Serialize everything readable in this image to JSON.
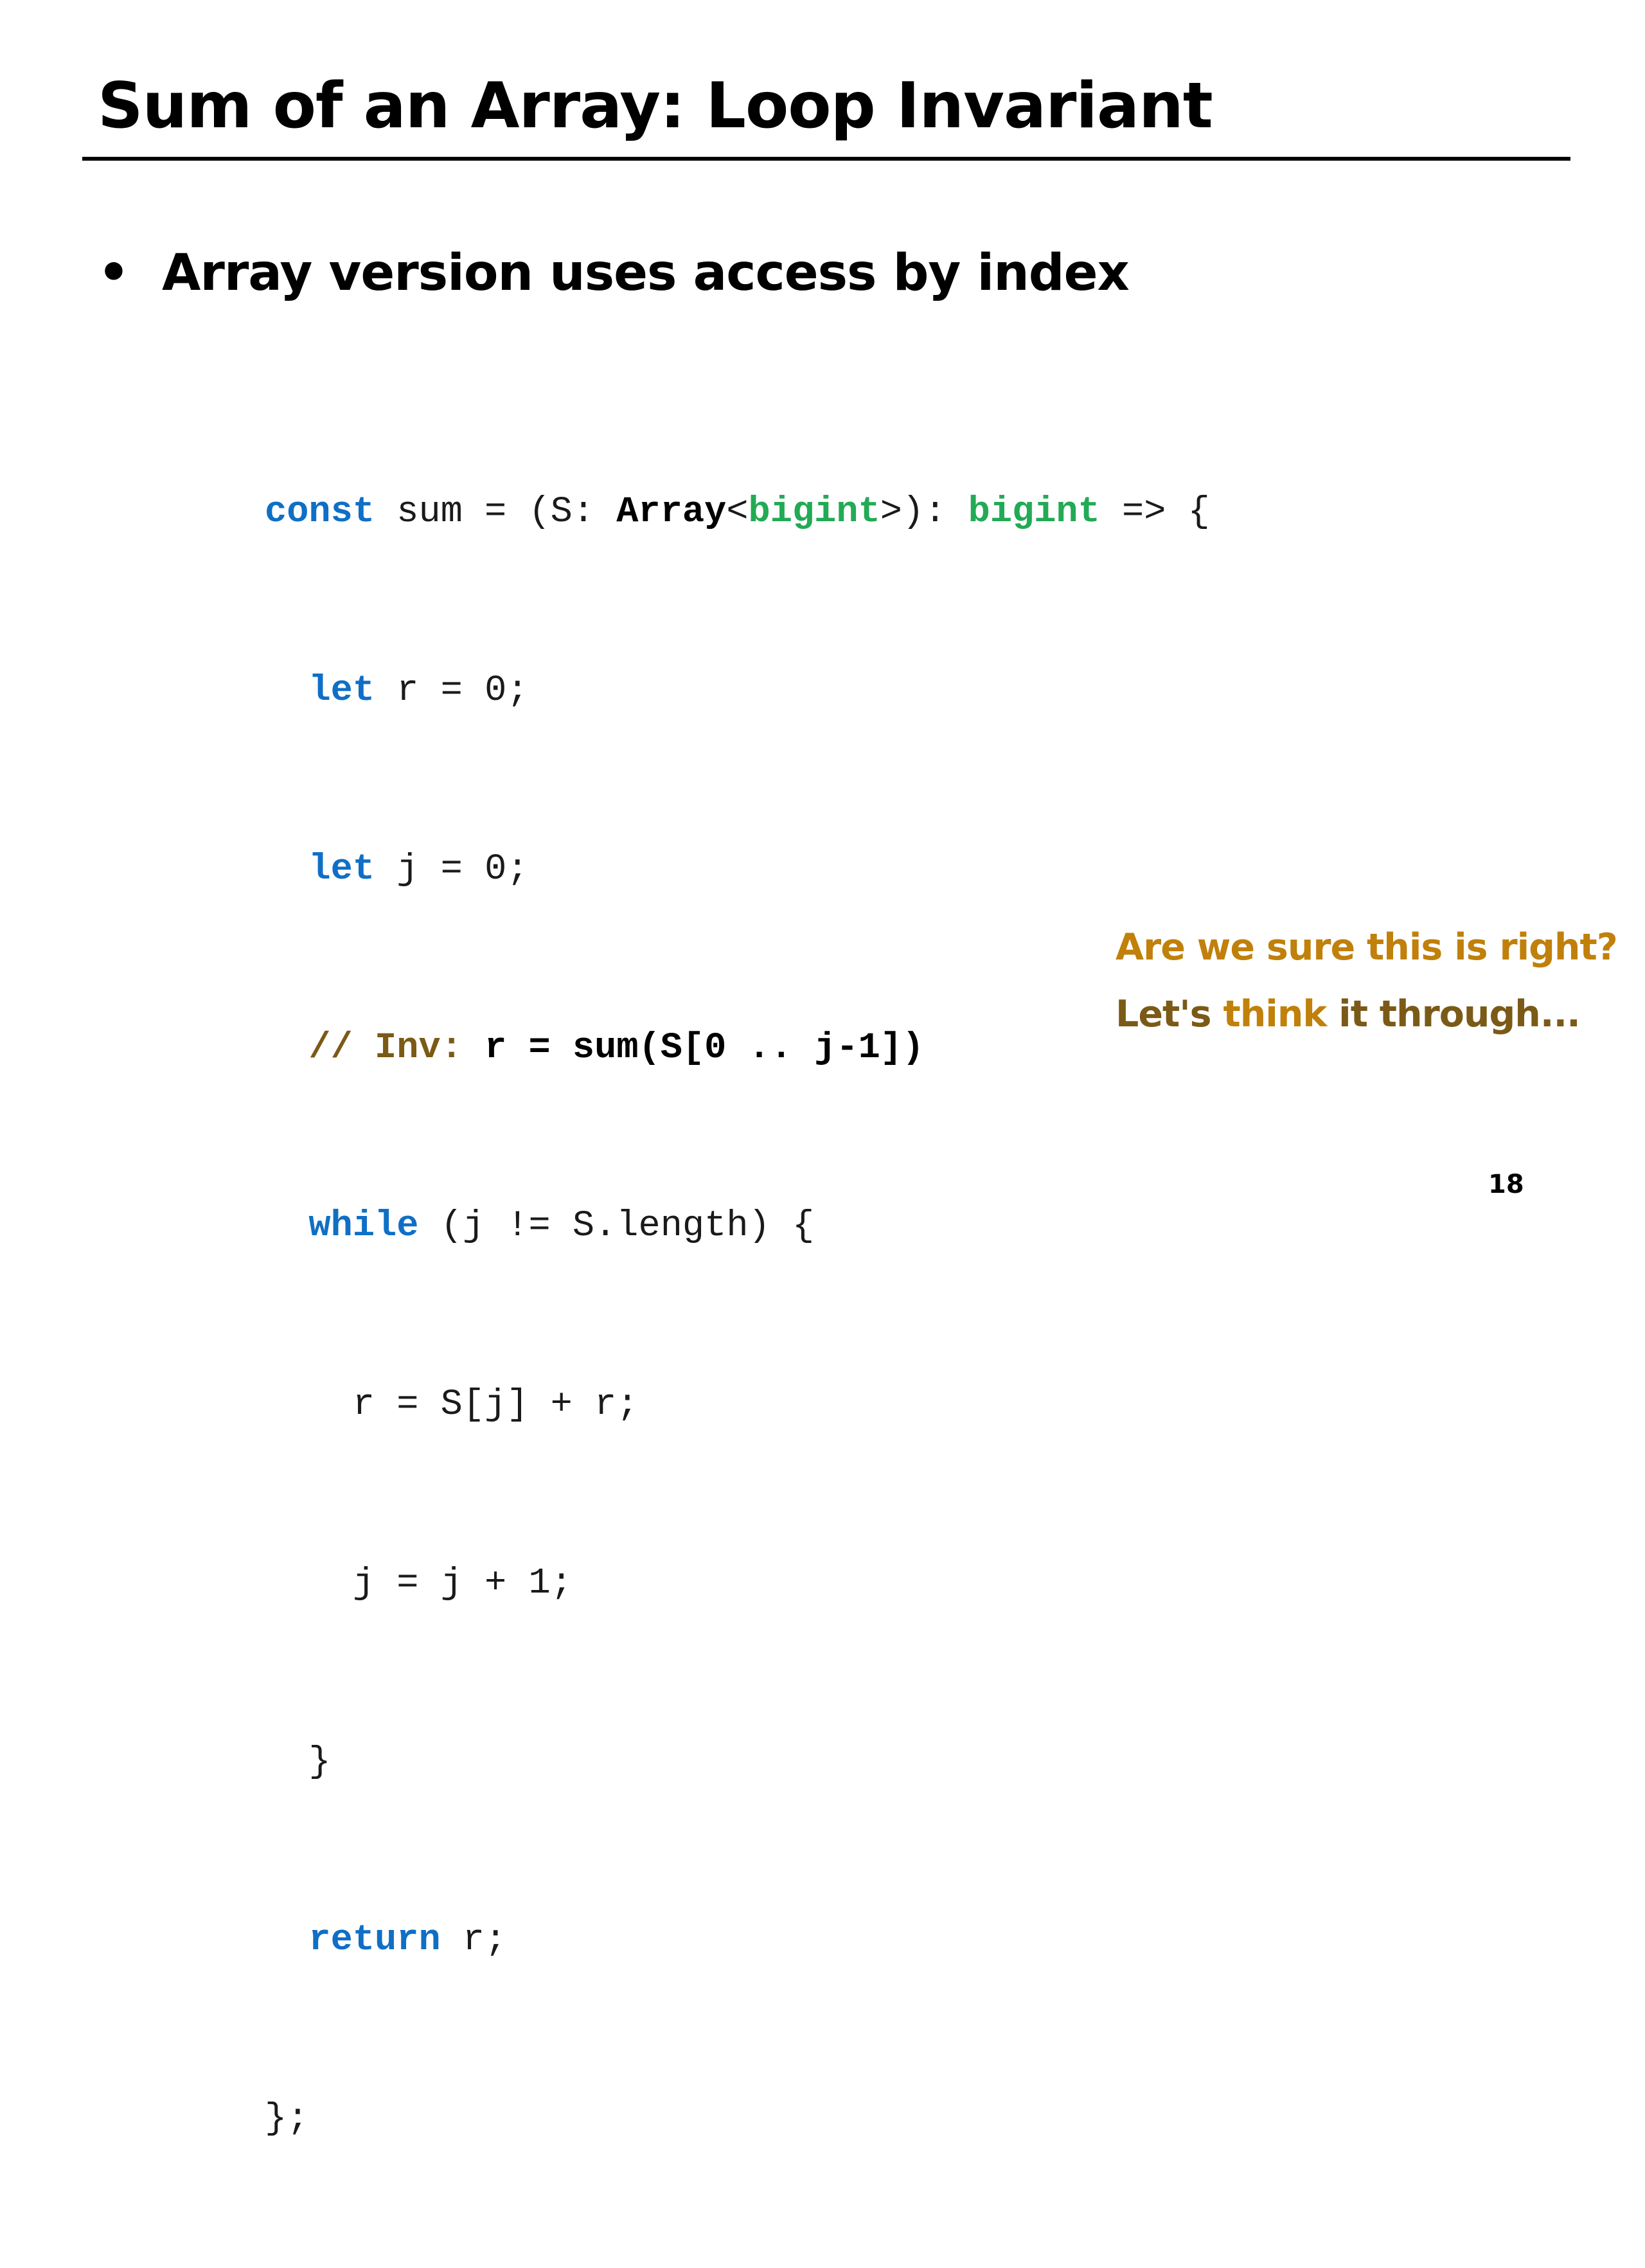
{
  "slide": {
    "title": "Sum of an Array: Loop Invariant",
    "bullet_marker": "•",
    "bullet_text": "Array version uses access by index",
    "code": {
      "line1": {
        "kw_const": "const",
        "t_sum_open": " sum = (S: ",
        "t_array": "Array",
        "t_lt": "<",
        "ty_bigint1": "bigint",
        "t_gt_colon": ">): ",
        "ty_bigint2": "bigint",
        "t_arrow": " => {"
      },
      "line2": {
        "indent": "  ",
        "kw_let": "let",
        "rest": " r = 0;"
      },
      "line3": {
        "indent": "  ",
        "kw_let": "let",
        "rest": " j = 0;"
      },
      "line4": {
        "indent": "  ",
        "comment": "// Inv:",
        "rest": " r = sum(S[0 .. j-1])"
      },
      "line5": {
        "indent": "  ",
        "kw_while": "while",
        "rest": " (j != S.length) {"
      },
      "line6": "    r = S[j] + r;",
      "line7": "    j = j + 1;",
      "line8": "  }",
      "line9": {
        "indent": "  ",
        "kw_return": "return",
        "rest": " r;"
      },
      "line10": "};"
    },
    "note_line1": "Are we sure this is right?",
    "note_line2": {
      "part1": "Let's ",
      "part2": "think",
      "part3": " it through..."
    },
    "page_number": "18"
  },
  "colors": {
    "keyword": "#0f6fc6",
    "type": "#22aa55",
    "comment": "#7b5a16",
    "note_primary": "#c0800a",
    "note_secondary": "#7a5a16"
  }
}
